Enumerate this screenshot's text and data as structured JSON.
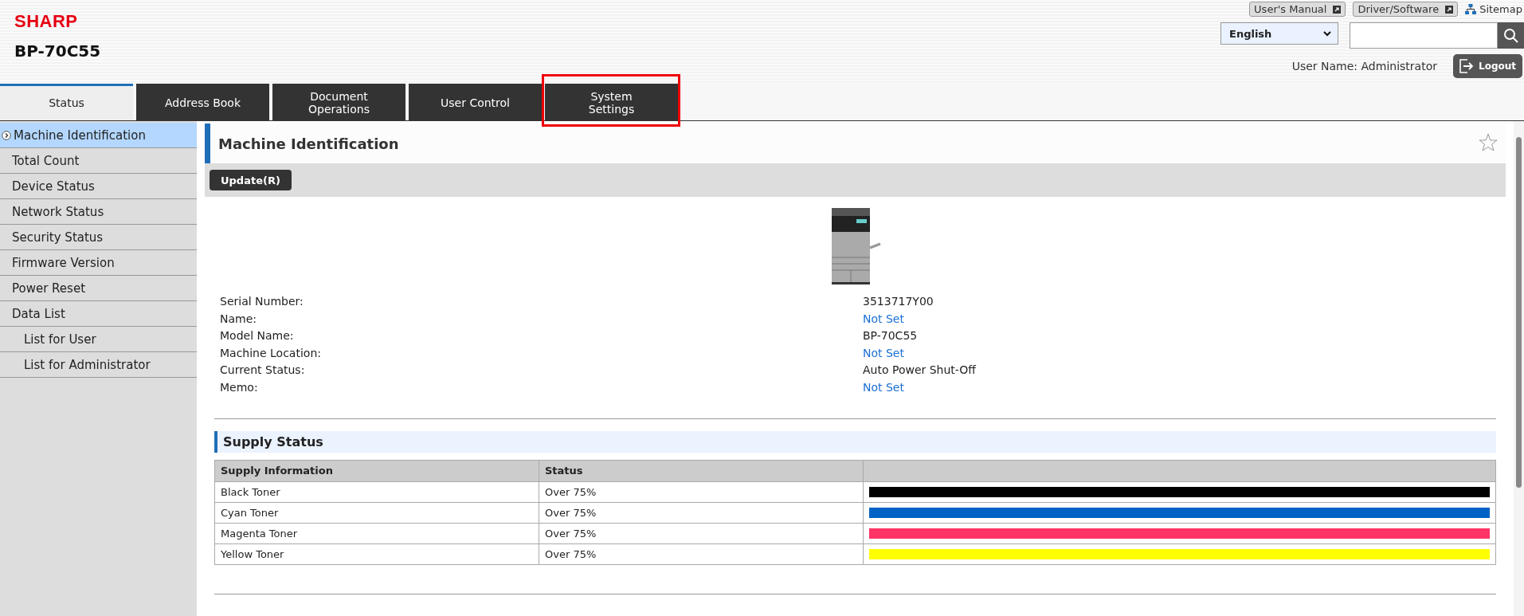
{
  "header": {
    "brand": "SHARP",
    "model": "BP-70C55",
    "links": [
      {
        "label": "User's Manual",
        "kind": "external"
      },
      {
        "label": "Driver/Software",
        "kind": "external"
      },
      {
        "label": "Sitemap",
        "kind": "sitemap"
      }
    ],
    "language": "English",
    "user_name": "User Name: Administrator",
    "logout": "Logout"
  },
  "tabs": [
    {
      "label": "Status",
      "selected": true,
      "highlighted": false
    },
    {
      "label": "Address Book",
      "selected": false,
      "highlighted": false
    },
    {
      "label": "Document\nOperations",
      "selected": false,
      "highlighted": false
    },
    {
      "label": "User Control",
      "selected": false,
      "highlighted": false
    },
    {
      "label": "System\nSettings",
      "selected": false,
      "highlighted": true
    }
  ],
  "sidebar": {
    "items": [
      {
        "label": "Machine Identification",
        "selected": true
      },
      {
        "label": "Total Count",
        "selected": false
      },
      {
        "label": "Device Status",
        "selected": false
      },
      {
        "label": "Network Status",
        "selected": false
      },
      {
        "label": "Security Status",
        "selected": false
      },
      {
        "label": "Firmware Version",
        "selected": false
      },
      {
        "label": "Power Reset",
        "selected": false
      },
      {
        "label": "Data List",
        "selected": false,
        "children": [
          {
            "label": "List for User",
            "selected": false
          },
          {
            "label": "List for Administrator",
            "selected": false
          }
        ]
      }
    ]
  },
  "page": {
    "title": "Machine Identification",
    "update_button": "Update(R)",
    "details": [
      {
        "label": "Serial Number:",
        "value": "3513717Y00",
        "kind": "text"
      },
      {
        "label": "Name:",
        "value": "Not Set",
        "kind": "link"
      },
      {
        "label": "Model Name:",
        "value": "BP-70C55",
        "kind": "text"
      },
      {
        "label": "Machine Location:",
        "value": "Not Set",
        "kind": "link"
      },
      {
        "label": "Current Status:",
        "value": "Auto Power Shut-Off",
        "kind": "text"
      },
      {
        "label": "Memo:",
        "value": "Not Set",
        "kind": "link"
      }
    ],
    "supply": {
      "title": "Supply Status",
      "columns": [
        "Supply Information",
        "Status"
      ],
      "rows": [
        {
          "name": "Black Toner",
          "status": "Over 75%",
          "level": 1,
          "color": "#000000"
        },
        {
          "name": "Cyan Toner",
          "status": "Over 75%",
          "level": 1,
          "color": "#0062c4"
        },
        {
          "name": "Magenta Toner",
          "status": "Over 75%",
          "level": 1,
          "color": "#ff3366"
        },
        {
          "name": "Yellow Toner",
          "status": "Over 75%",
          "level": 1,
          "color": "#ffff00"
        }
      ]
    }
  }
}
